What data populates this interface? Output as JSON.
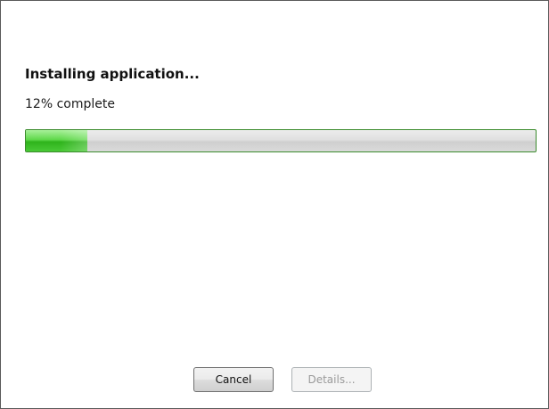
{
  "dialog": {
    "heading": "Installing application...",
    "status_text": "12% complete",
    "progress_percent": 12,
    "buttons": {
      "cancel_label": "Cancel",
      "details_label": "Details..."
    }
  },
  "colors": {
    "progress_fill": "#3cc229",
    "progress_border": "#3b8b2d",
    "window_border": "#5a5a5a"
  }
}
